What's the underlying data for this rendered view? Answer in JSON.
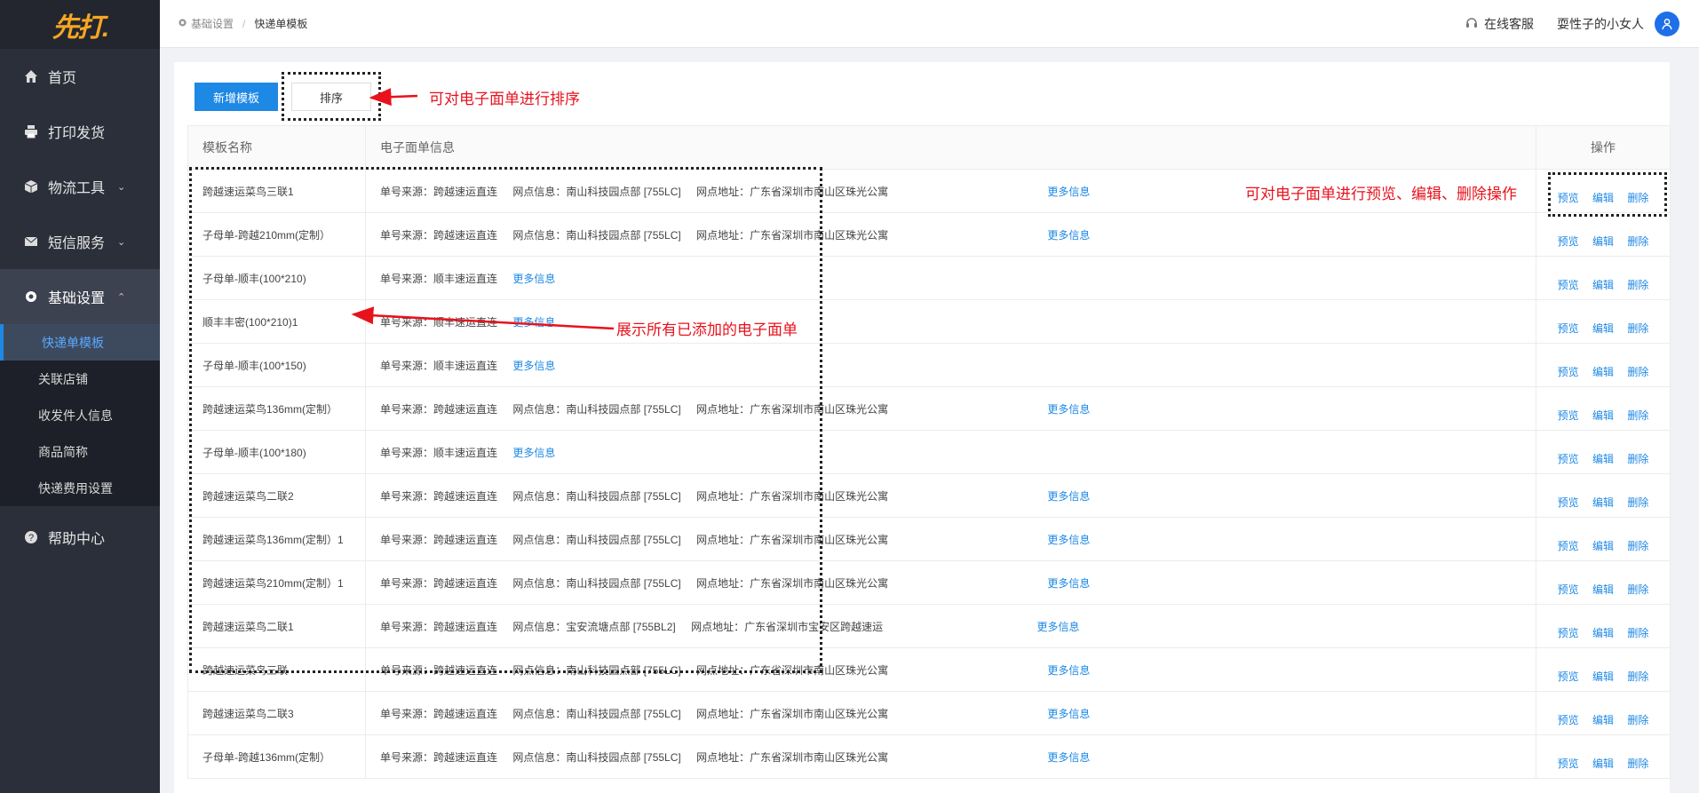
{
  "logo": "先打.",
  "sidebar": {
    "items": [
      {
        "label": "首页",
        "icon": "home-icon"
      },
      {
        "label": "打印发货",
        "icon": "printer-icon"
      },
      {
        "label": "物流工具",
        "icon": "box-icon"
      },
      {
        "label": "短信服务",
        "icon": "mail-icon"
      },
      {
        "label": "基础设置",
        "icon": "gear-icon"
      }
    ],
    "submenu": [
      "快递单模板",
      "关联店铺",
      "收发件人信息",
      "商品简称",
      "快递费用设置"
    ],
    "help": "帮助中心"
  },
  "header": {
    "breadcrumb_parent": "基础设置",
    "breadcrumb_current": "快递单模板",
    "support": "在线客服",
    "user": "耍性子的小女人"
  },
  "toolbar": {
    "add_label": "新增模板",
    "sort_label": "排序"
  },
  "table": {
    "col_name": "模板名称",
    "col_info": "电子面单信息",
    "col_ops": "操作",
    "op_preview": "预览",
    "op_edit": "编辑",
    "op_delete": "删除",
    "more": "更多信息",
    "rows": [
      {
        "name": "跨越速运菜鸟三联1",
        "source": "单号来源：跨越速运直连",
        "outlet": "网点信息：南山科技园点部 [755LC]",
        "address": "网点地址：广东省深圳市南山区珠光公寓"
      },
      {
        "name": "子母单-跨越210mm(定制）",
        "source": "单号来源：跨越速运直连",
        "outlet": "网点信息：南山科技园点部 [755LC]",
        "address": "网点地址：广东省深圳市南山区珠光公寓"
      },
      {
        "name": "子母单-顺丰(100*210)",
        "source": "单号来源：顺丰速运直连",
        "outlet": "",
        "address": ""
      },
      {
        "name": "顺丰丰密(100*210)1",
        "source": "单号来源：顺丰速运直连",
        "outlet": "",
        "address": ""
      },
      {
        "name": "子母单-顺丰(100*150)",
        "source": "单号来源：顺丰速运直连",
        "outlet": "",
        "address": ""
      },
      {
        "name": "跨越速运菜鸟136mm(定制）",
        "source": "单号来源：跨越速运直连",
        "outlet": "网点信息：南山科技园点部 [755LC]",
        "address": "网点地址：广东省深圳市南山区珠光公寓"
      },
      {
        "name": "子母单-顺丰(100*180)",
        "source": "单号来源：顺丰速运直连",
        "outlet": "",
        "address": ""
      },
      {
        "name": "跨越速运菜鸟二联2",
        "source": "单号来源：跨越速运直连",
        "outlet": "网点信息：南山科技园点部 [755LC]",
        "address": "网点地址：广东省深圳市南山区珠光公寓"
      },
      {
        "name": "跨越速运菜鸟136mm(定制）1",
        "source": "单号来源：跨越速运直连",
        "outlet": "网点信息：南山科技园点部 [755LC]",
        "address": "网点地址：广东省深圳市南山区珠光公寓"
      },
      {
        "name": "跨越速运菜鸟210mm(定制）1",
        "source": "单号来源：跨越速运直连",
        "outlet": "网点信息：南山科技园点部 [755LC]",
        "address": "网点地址：广东省深圳市南山区珠光公寓"
      },
      {
        "name": "跨越速运菜鸟二联1",
        "source": "单号来源：跨越速运直连",
        "outlet": "网点信息：宝安流塘点部 [755BL2]",
        "address": "网点地址：广东省深圳市宝安区跨越速运"
      },
      {
        "name": "跨越速运菜鸟三联",
        "source": "单号来源：跨越速运直连",
        "outlet": "网点信息：南山科技园点部 [755LC]",
        "address": "网点地址：广东省深圳市南山区珠光公寓"
      },
      {
        "name": "跨越速运菜鸟二联3",
        "source": "单号来源：跨越速运直连",
        "outlet": "网点信息：南山科技园点部 [755LC]",
        "address": "网点地址：广东省深圳市南山区珠光公寓"
      },
      {
        "name": "子母单-跨越136mm(定制）",
        "source": "单号来源：跨越速运直连",
        "outlet": "网点信息：南山科技园点部 [755LC]",
        "address": "网点地址：广东省深圳市南山区珠光公寓"
      }
    ]
  },
  "annotations": {
    "sort": "可对电子面单进行排序",
    "ops": "可对电子面单进行预览、编辑、删除操作",
    "list": "展示所有已添加的电子面单"
  },
  "colors": {
    "accent": "#1e88e5",
    "sidebar": "#2b2f3a",
    "annotation": "#e8121d"
  }
}
